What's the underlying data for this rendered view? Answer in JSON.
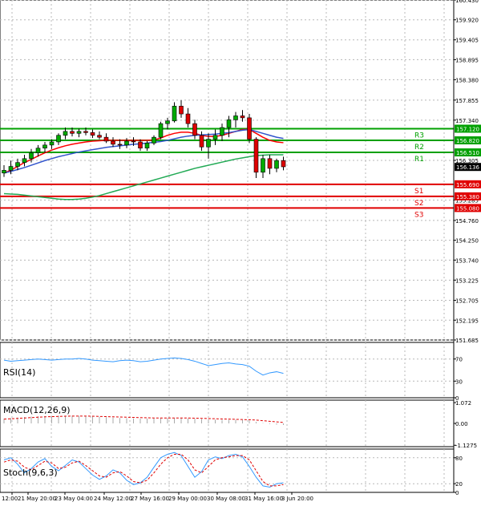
{
  "chart_data": [
    {
      "type": "candlestick",
      "panel": "price",
      "ylim": [
        151.685,
        160.43
      ],
      "y_ticks": [
        "160.430",
        "159.920",
        "159.405",
        "158.895",
        "158.380",
        "157.855",
        "157.340",
        "156.305",
        "155.285",
        "154.760",
        "154.250",
        "153.740",
        "153.225",
        "152.705",
        "152.195",
        "151.685"
      ],
      "x_ticks": [
        "12:00",
        "21 May 20:00",
        "23 May 04:00",
        "24 May 12:00",
        "27 May 16:00",
        "29 May 00:00",
        "30 May 08:00",
        "31 May 16:00",
        "3 Jun 20:00"
      ],
      "candles": [
        {
          "o": 155.98,
          "h": 156.18,
          "l": 155.88,
          "c": 156.05
        },
        {
          "o": 156.05,
          "h": 156.3,
          "l": 155.95,
          "c": 156.15
        },
        {
          "o": 156.15,
          "h": 156.35,
          "l": 156.05,
          "c": 156.25
        },
        {
          "o": 156.25,
          "h": 156.45,
          "l": 156.15,
          "c": 156.35
        },
        {
          "o": 156.35,
          "h": 156.6,
          "l": 156.25,
          "c": 156.5
        },
        {
          "o": 156.5,
          "h": 156.7,
          "l": 156.4,
          "c": 156.62
        },
        {
          "o": 156.62,
          "h": 156.78,
          "l": 156.5,
          "c": 156.7
        },
        {
          "o": 156.7,
          "h": 156.85,
          "l": 156.6,
          "c": 156.78
        },
        {
          "o": 156.78,
          "h": 157.0,
          "l": 156.7,
          "c": 156.95
        },
        {
          "o": 156.95,
          "h": 157.15,
          "l": 156.85,
          "c": 157.05
        },
        {
          "o": 157.05,
          "h": 157.15,
          "l": 156.92,
          "c": 157.0
        },
        {
          "o": 157.0,
          "h": 157.12,
          "l": 156.9,
          "c": 157.05
        },
        {
          "o": 157.05,
          "h": 157.15,
          "l": 156.95,
          "c": 157.02
        },
        {
          "o": 157.02,
          "h": 157.1,
          "l": 156.88,
          "c": 156.95
        },
        {
          "o": 156.95,
          "h": 157.05,
          "l": 156.85,
          "c": 156.9
        },
        {
          "o": 156.9,
          "h": 157.0,
          "l": 156.75,
          "c": 156.8
        },
        {
          "o": 156.8,
          "h": 156.9,
          "l": 156.65,
          "c": 156.72
        },
        {
          "o": 156.72,
          "h": 156.85,
          "l": 156.6,
          "c": 156.7
        },
        {
          "o": 156.7,
          "h": 156.88,
          "l": 156.62,
          "c": 156.8
        },
        {
          "o": 156.8,
          "h": 156.9,
          "l": 156.68,
          "c": 156.78
        },
        {
          "o": 156.78,
          "h": 156.85,
          "l": 156.55,
          "c": 156.62
        },
        {
          "o": 156.62,
          "h": 156.8,
          "l": 156.55,
          "c": 156.75
        },
        {
          "o": 156.75,
          "h": 156.95,
          "l": 156.7,
          "c": 156.9
        },
        {
          "o": 156.9,
          "h": 157.3,
          "l": 156.85,
          "c": 157.25
        },
        {
          "o": 157.25,
          "h": 157.4,
          "l": 157.1,
          "c": 157.32
        },
        {
          "o": 157.32,
          "h": 157.8,
          "l": 157.28,
          "c": 157.7
        },
        {
          "o": 157.7,
          "h": 157.85,
          "l": 157.4,
          "c": 157.5
        },
        {
          "o": 157.5,
          "h": 157.65,
          "l": 157.15,
          "c": 157.25
        },
        {
          "o": 157.25,
          "h": 157.35,
          "l": 156.85,
          "c": 156.95
        },
        {
          "o": 156.95,
          "h": 157.05,
          "l": 156.55,
          "c": 156.65
        },
        {
          "o": 156.65,
          "h": 157.0,
          "l": 156.35,
          "c": 156.85
        },
        {
          "o": 156.85,
          "h": 157.1,
          "l": 156.7,
          "c": 156.95
        },
        {
          "o": 156.95,
          "h": 157.25,
          "l": 156.8,
          "c": 157.15
        },
        {
          "o": 157.15,
          "h": 157.45,
          "l": 156.9,
          "c": 157.35
        },
        {
          "o": 157.35,
          "h": 157.55,
          "l": 157.15,
          "c": 157.45
        },
        {
          "o": 157.45,
          "h": 157.6,
          "l": 157.3,
          "c": 157.4
        },
        {
          "o": 157.4,
          "h": 157.5,
          "l": 156.75,
          "c": 156.85
        },
        {
          "o": 156.85,
          "h": 156.9,
          "l": 155.85,
          "c": 156.0
        },
        {
          "o": 156.0,
          "h": 156.45,
          "l": 155.85,
          "c": 156.35
        },
        {
          "o": 156.35,
          "h": 156.45,
          "l": 155.95,
          "c": 156.1
        },
        {
          "o": 156.1,
          "h": 156.35,
          "l": 156.0,
          "c": 156.3
        },
        {
          "o": 156.3,
          "h": 156.4,
          "l": 156.05,
          "c": 156.14
        }
      ],
      "series": [
        {
          "color": "#ff0000",
          "values": [
            155.98,
            156.05,
            156.15,
            156.25,
            156.33,
            156.42,
            156.5,
            156.57,
            156.63,
            156.68,
            156.72,
            156.75,
            156.78,
            156.8,
            156.81,
            156.82,
            156.82,
            156.82,
            156.82,
            156.82,
            156.82,
            156.82,
            156.83,
            156.88,
            156.95,
            157.0,
            157.03,
            157.03,
            157.0,
            156.95,
            156.92,
            156.92,
            156.95,
            157.0,
            157.05,
            157.1,
            157.1,
            157.0,
            156.9,
            156.82,
            156.78,
            156.76
          ]
        },
        {
          "color": "#3355cc",
          "values": [
            155.98,
            156.02,
            156.07,
            156.12,
            156.18,
            156.24,
            156.3,
            156.35,
            156.4,
            156.44,
            156.48,
            156.52,
            156.55,
            156.58,
            156.61,
            156.64,
            156.66,
            156.68,
            156.7,
            156.72,
            156.73,
            156.75,
            156.77,
            156.79,
            156.82,
            156.86,
            156.9,
            156.93,
            156.95,
            156.96,
            156.97,
            156.98,
            157.0,
            157.02,
            157.05,
            157.08,
            157.1,
            157.05,
            157.0,
            156.95,
            156.9,
            156.87
          ]
        },
        {
          "color": "#22aa55",
          "values": [
            155.45,
            155.44,
            155.43,
            155.41,
            155.39,
            155.37,
            155.35,
            155.33,
            155.31,
            155.3,
            155.3,
            155.31,
            155.33,
            155.36,
            155.4,
            155.45,
            155.5,
            155.55,
            155.6,
            155.65,
            155.7,
            155.75,
            155.8,
            155.85,
            155.9,
            155.95,
            156.0,
            156.05,
            156.1,
            156.14,
            156.18,
            156.22,
            156.26,
            156.3,
            156.34,
            156.37,
            156.4,
            156.43,
            156.44,
            156.45,
            156.45,
            156.45
          ]
        }
      ],
      "levels": [
        {
          "label": "R3",
          "value": 157.12,
          "tag": "157.120",
          "color": "#00a000"
        },
        {
          "label": "R2",
          "value": 156.82,
          "tag": "156.820",
          "color": "#00a000"
        },
        {
          "label": "R1",
          "value": 156.51,
          "tag": "156.510",
          "color": "#00a000"
        },
        {
          "label": "S1",
          "value": 155.69,
          "tag": "155.690",
          "color": "#e00000"
        },
        {
          "label": "S2",
          "value": 155.38,
          "tag": "155.380",
          "color": "#e00000"
        },
        {
          "label": "S3",
          "value": 155.08,
          "tag": "155.080",
          "color": "#e00000"
        }
      ],
      "last_price": {
        "value": 156.136,
        "tag": "156.136"
      }
    },
    {
      "type": "line",
      "panel": "rsi",
      "title": "RSI(14)",
      "ylim": [
        0,
        100
      ],
      "y_ticks": [
        "70",
        "30",
        "0"
      ],
      "series": [
        {
          "color": "#3399ff",
          "values": [
            68,
            66,
            67,
            68,
            69,
            70,
            69,
            68,
            69,
            70,
            70,
            71,
            70,
            68,
            67,
            66,
            65,
            67,
            68,
            67,
            65,
            66,
            68,
            70,
            71,
            72,
            71,
            69,
            66,
            62,
            58,
            60,
            62,
            63,
            61,
            60,
            57,
            48,
            41,
            45,
            47,
            44
          ]
        }
      ]
    },
    {
      "type": "bar",
      "panel": "macd",
      "title": "MACD(12,26,9)",
      "ylim": [
        -1.2,
        1.2
      ],
      "y_ticks": [
        "1.072",
        "0.00",
        "-1.1275"
      ],
      "values": [
        0.25,
        0.28,
        0.3,
        0.33,
        0.35,
        0.37,
        0.38,
        0.39,
        0.4,
        0.4,
        0.4,
        0.39,
        0.38,
        0.36,
        0.34,
        0.32,
        0.3,
        0.28,
        0.27,
        0.26,
        0.25,
        0.25,
        0.26,
        0.27,
        0.28,
        0.29,
        0.28,
        0.26,
        0.24,
        0.22,
        0.2,
        0.19,
        0.18,
        0.18,
        0.19,
        0.18,
        0.15,
        0.08,
        0.02,
        -0.03,
        -0.06,
        -0.08
      ],
      "series": [
        {
          "color": "#e00000",
          "values": [
            0.22,
            0.24,
            0.26,
            0.28,
            0.3,
            0.32,
            0.34,
            0.35,
            0.36,
            0.37,
            0.38,
            0.38,
            0.38,
            0.37,
            0.36,
            0.35,
            0.34,
            0.33,
            0.32,
            0.31,
            0.3,
            0.29,
            0.28,
            0.28,
            0.28,
            0.28,
            0.28,
            0.28,
            0.27,
            0.26,
            0.25,
            0.24,
            0.23,
            0.22,
            0.21,
            0.2,
            0.19,
            0.17,
            0.14,
            0.11,
            0.08,
            0.05
          ]
        }
      ]
    },
    {
      "type": "line",
      "panel": "stoch",
      "title": "Stoch(9,6,3)",
      "ylim": [
        0,
        100
      ],
      "y_ticks": [
        "80",
        "20",
        "0"
      ],
      "series": [
        {
          "color": "#3399ff",
          "values": [
            75,
            80,
            65,
            45,
            55,
            70,
            78,
            60,
            50,
            62,
            75,
            70,
            55,
            40,
            30,
            38,
            52,
            45,
            28,
            18,
            22,
            35,
            58,
            80,
            88,
            92,
            85,
            60,
            35,
            48,
            75,
            82,
            78,
            85,
            88,
            82,
            60,
            35,
            15,
            12,
            20,
            22
          ]
        },
        {
          "color": "#e00000",
          "values": [
            70,
            75,
            72,
            58,
            52,
            62,
            72,
            68,
            55,
            58,
            68,
            72,
            62,
            50,
            38,
            35,
            45,
            48,
            38,
            25,
            22,
            28,
            45,
            65,
            80,
            88,
            88,
            75,
            52,
            45,
            60,
            75,
            80,
            82,
            85,
            85,
            75,
            50,
            25,
            15,
            15,
            18
          ]
        }
      ]
    }
  ]
}
